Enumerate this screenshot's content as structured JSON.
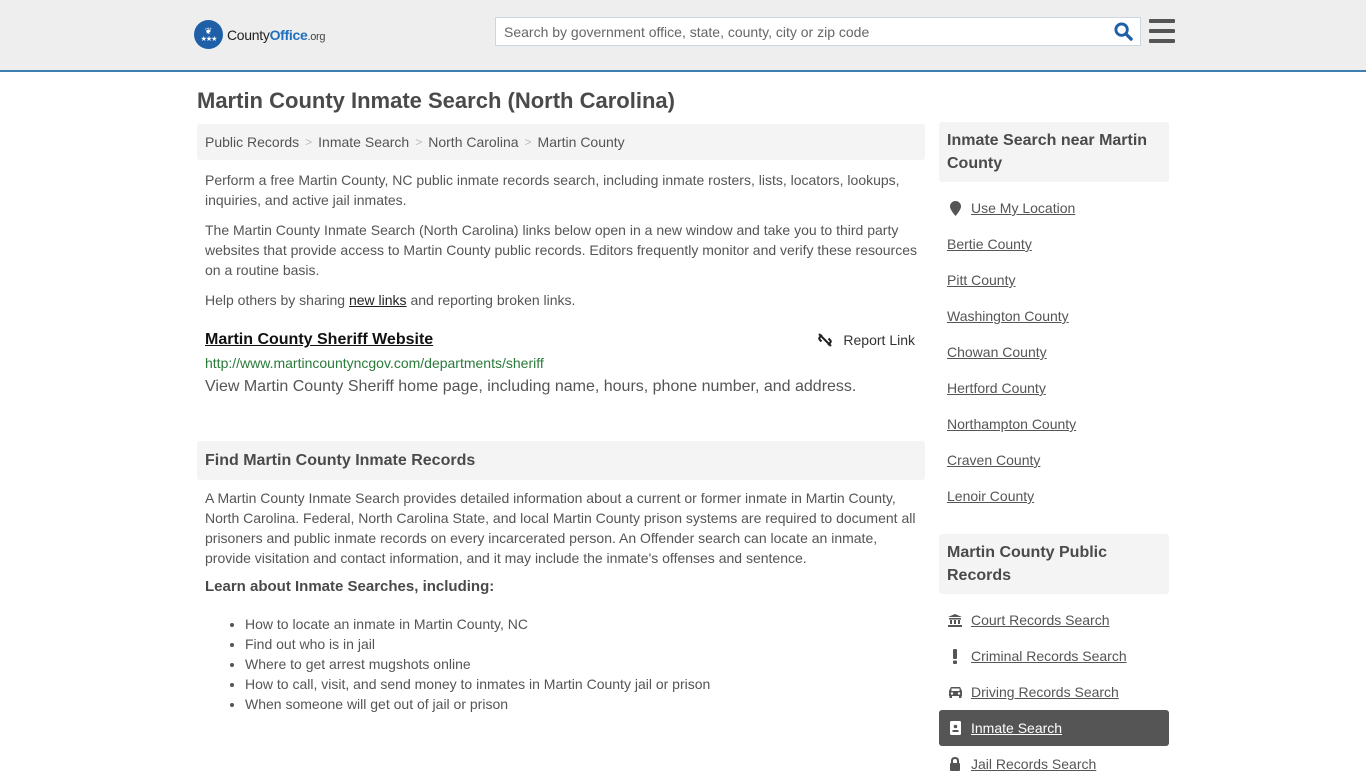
{
  "header": {
    "logo": {
      "brand_part1": "County",
      "brand_part2": "Office",
      "brand_suffix": ".org"
    },
    "search": {
      "placeholder": "Search by government office, state, county, city or zip code",
      "value": ""
    },
    "icons": {
      "search": "search-icon",
      "menu": "hamburger-menu-icon"
    }
  },
  "page": {
    "title": "Martin County Inmate Search (North Carolina)"
  },
  "breadcrumb": [
    {
      "label": "Public Records"
    },
    {
      "label": "Inmate Search"
    },
    {
      "label": "North Carolina"
    },
    {
      "label": "Martin County"
    }
  ],
  "breadcrumb_separator": ">",
  "intro": {
    "p1": "Perform a free Martin County, NC public inmate records search, including inmate rosters, lists, locators, lookups, inquiries, and active jail inmates.",
    "p2": "The Martin County Inmate Search (North Carolina) links below open in a new window and take you to third party websites that provide access to Martin County public records. Editors frequently monitor and verify these resources on a routine basis.",
    "p3_before": "Help others by sharing ",
    "p3_link": "new links",
    "p3_after": " and reporting broken links."
  },
  "resource": {
    "title": "Martin County Sheriff Website",
    "url": "http://www.martincountyncgov.com/departments/sheriff",
    "description": "View Martin County Sheriff home page, including name, hours, phone number, and address.",
    "report_label": "Report Link"
  },
  "find_section": {
    "heading": "Find Martin County Inmate Records",
    "body": "A Martin County Inmate Search provides detailed information about a current or former inmate in Martin County, North Carolina. Federal, North Carolina State, and local Martin County prison systems are required to document all prisoners and public inmate records on every incarcerated person. An Offender search can locate an inmate, provide visitation and contact information, and it may include the inmate's offenses and sentence.",
    "learn_heading": "Learn about Inmate Searches, including:",
    "bullets": [
      "How to locate an inmate in Martin County, NC",
      "Find out who is in jail",
      "Where to get arrest mugshots online",
      "How to call, visit, and send money to inmates in Martin County jail or prison",
      "When someone will get out of jail or prison"
    ]
  },
  "sidebar": {
    "nearby_heading": "Inmate Search near Martin County",
    "use_location": "Use My Location",
    "nearby": [
      "Bertie County",
      "Pitt County",
      "Washington County",
      "Chowan County",
      "Hertford County",
      "Northampton County",
      "Craven County",
      "Lenoir County"
    ],
    "records_heading": "Martin County Public Records",
    "records": [
      {
        "label": "Court Records Search",
        "icon": "courthouse-icon",
        "active": false
      },
      {
        "label": "Criminal Records Search",
        "icon": "exclamation-icon",
        "active": false
      },
      {
        "label": "Driving Records Search",
        "icon": "car-icon",
        "active": false
      },
      {
        "label": "Inmate Search",
        "icon": "id-badge-icon",
        "active": true
      },
      {
        "label": "Jail Records Search",
        "icon": "lock-icon",
        "active": false
      }
    ]
  },
  "colors": {
    "header_bg": "#eeeeee",
    "header_border": "#3d7eb0",
    "brand_blue": "#1e6fbf",
    "url_green": "#2a7a3a",
    "active_bg": "#555555"
  }
}
